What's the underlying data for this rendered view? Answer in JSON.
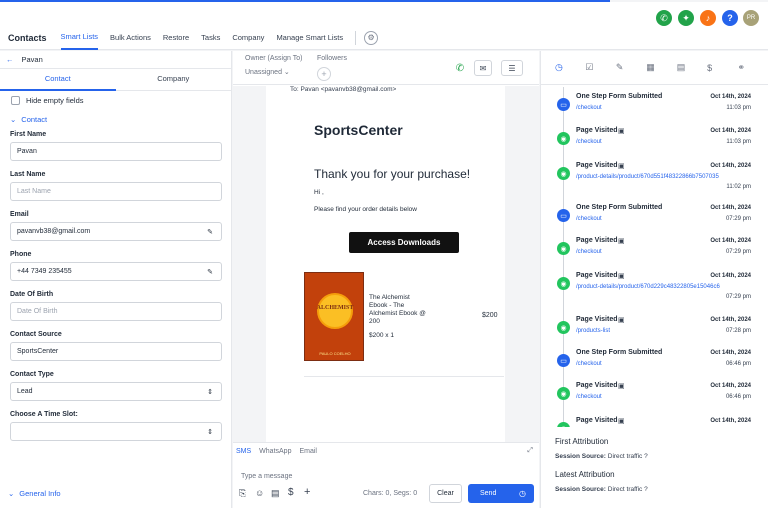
{
  "topbar": {
    "icons": [
      {
        "name": "phone-icon",
        "color": "#22a34a",
        "glyph": "✆"
      },
      {
        "name": "megaphone-icon",
        "color": "#22a34a",
        "glyph": "✦"
      },
      {
        "name": "bell-icon",
        "color": "#f97316",
        "glyph": "♪"
      },
      {
        "name": "help-icon",
        "color": "#2563eb",
        "glyph": "?"
      }
    ],
    "avatar_initials": "PR"
  },
  "nav": {
    "title": "Contacts",
    "items": [
      "Smart Lists",
      "Bulk Actions",
      "Restore",
      "Tasks",
      "Company",
      "Manage Smart Lists"
    ]
  },
  "left": {
    "contact_name": "Pavan",
    "tabs": [
      "Contact",
      "Company"
    ],
    "hide_empty": "Hide empty fields",
    "section": "Contact",
    "fields": [
      {
        "label": "First Name",
        "value": "Pavan",
        "placeholder": ""
      },
      {
        "label": "Last Name",
        "value": "",
        "placeholder": "Last Name"
      },
      {
        "label": "Email",
        "value": "pavanvb38@gmail.com",
        "placeholder": ""
      },
      {
        "label": "Phone",
        "value": "+44 7349 235455",
        "placeholder": ""
      },
      {
        "label": "Date Of Birth",
        "value": "",
        "placeholder": "Date Of Birth"
      },
      {
        "label": "Contact Source",
        "value": "SportsCenter",
        "placeholder": ""
      },
      {
        "label": "Contact Type",
        "value": "Lead",
        "placeholder": ""
      },
      {
        "label": "Choose A Time Slot:",
        "value": "",
        "placeholder": ""
      }
    ],
    "general_info": "General Info"
  },
  "middle": {
    "owner_label": "Owner (Assign To)",
    "owner_value": "Unassigned",
    "followers_label": "Followers",
    "email": {
      "to": "To: Pavan <pavanvb38@gmail.com>",
      "brand": "SportsCenter",
      "heading": "Thank you for your purchase!",
      "greeting": "Hi ,",
      "body": "Please find your order details below",
      "button": "Access Downloads",
      "product_name": "The Alchemist Ebook - The Alchemist Ebook @ 200",
      "product_qty": "$200 x 1",
      "product_price": "$200",
      "book_title": "ALCHEMIST",
      "book_author": "PAULO COELHO"
    },
    "compose": {
      "tabs": [
        "SMS",
        "WhatsApp",
        "Email"
      ],
      "placeholder": "Type a message",
      "counter": "Chars: 0, Segs: 0",
      "clear": "Clear",
      "send": "Send"
    }
  },
  "right": {
    "events": [
      {
        "type": "form",
        "title": "One Step Form Submitted",
        "link": "/checkout",
        "date": "Oct 14th, 2024",
        "time": "11:03 pm"
      },
      {
        "type": "page",
        "title": "Page Visited",
        "link": "/checkout",
        "date": "Oct 14th, 2024",
        "time": "11:03 pm"
      },
      {
        "type": "page",
        "title": "Page Visited",
        "link": "/product-details/product/670d551f48322866b7507035",
        "date": "Oct 14th, 2024",
        "time": "11:02 pm"
      },
      {
        "type": "form",
        "title": "One Step Form Submitted",
        "link": "/checkout",
        "date": "Oct 14th, 2024",
        "time": "07:29 pm"
      },
      {
        "type": "page",
        "title": "Page Visited",
        "link": "/checkout",
        "date": "Oct 14th, 2024",
        "time": "07:29 pm"
      },
      {
        "type": "page",
        "title": "Page Visited",
        "link": "/product-details/product/670d229c48322805e15046c6",
        "date": "Oct 14th, 2024",
        "time": "07:29 pm"
      },
      {
        "type": "page",
        "title": "Page Visited",
        "link": "/products-list",
        "date": "Oct 14th, 2024",
        "time": "07:28 pm"
      },
      {
        "type": "form",
        "title": "One Step Form Submitted",
        "link": "/checkout",
        "date": "Oct 14th, 2024",
        "time": "06:46 pm"
      },
      {
        "type": "page",
        "title": "Page Visited",
        "link": "/checkout",
        "date": "Oct 14th, 2024",
        "time": "06:46 pm"
      },
      {
        "type": "page",
        "title": "Page Visited",
        "link": "",
        "date": "Oct 14th, 2024",
        "time": ""
      }
    ],
    "first_attribution": "First Attribution",
    "latest_attribution": "Latest Attribution",
    "session_label": "Session Source:",
    "session_value": "Direct traffic",
    "colors": {
      "form": "#2563eb",
      "page": "#22c55e"
    }
  }
}
